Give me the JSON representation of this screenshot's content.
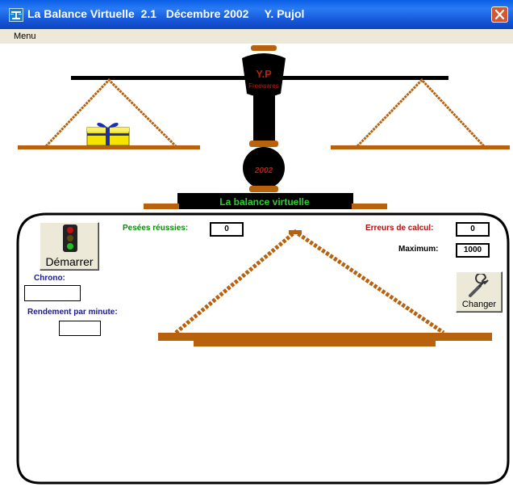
{
  "window": {
    "title": "La Balance Virtuelle  2.1   Décembre 2002     Y. Pujol"
  },
  "menu": {
    "item": "Menu"
  },
  "scale": {
    "logo_top": "Y.P",
    "logo_sub": "Freewares",
    "year": "2002",
    "banner": "La balance virtuelle"
  },
  "panel": {
    "start_button": "Démarrer",
    "change_button": "Changer",
    "success_label": "Pesées réussies:",
    "success_value": "0",
    "errors_label": "Erreurs de calcul:",
    "errors_value": "0",
    "max_label": "Maximum:",
    "max_value": "1000",
    "chrono_label": "Chrono:",
    "chrono_value": "",
    "rate_label": "Rendement par minute:",
    "rate_value": ""
  },
  "colors": {
    "brown": "#b8620e",
    "dark_brown": "#7a3e08",
    "success_green": "#0a8a0a",
    "error_red": "#b01010",
    "navy": "#1a1a8a",
    "banner_green": "#2ecc2e",
    "logo_red": "#b82010"
  },
  "icons": [
    "traffic-light-icon",
    "wrench-icon",
    "gift-icon",
    "close-icon",
    "app-icon"
  ]
}
